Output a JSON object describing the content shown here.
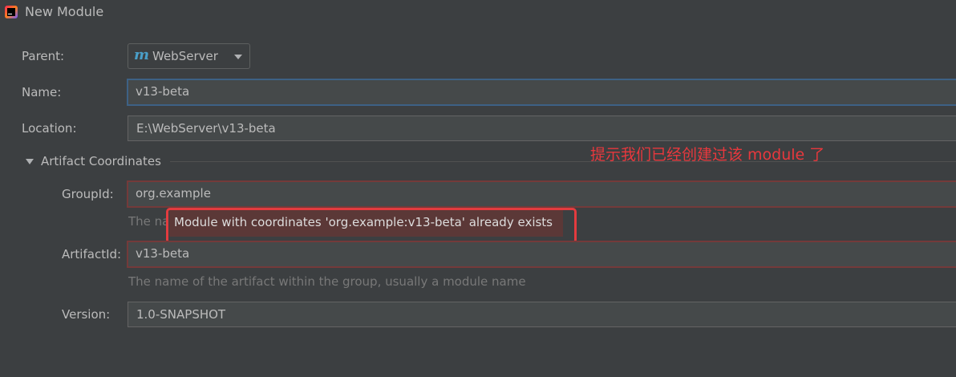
{
  "window": {
    "title": "New Module"
  },
  "form": {
    "parent": {
      "label": "Parent:",
      "value": "WebServer"
    },
    "name": {
      "label": "Name:",
      "value": "v13-beta"
    },
    "location": {
      "label": "Location:",
      "value": "E:\\WebServer\\v13-beta"
    },
    "artifact_section": {
      "title": "Artifact Coordinates"
    },
    "group_id": {
      "label": "GroupId:",
      "value": "org.example",
      "hint_prefix": "The na"
    },
    "error_tooltip": {
      "message": "Module with coordinates 'org.example:v13-beta' already exists"
    },
    "artifact_id": {
      "label": "ArtifactId:",
      "value": "v13-beta",
      "hint": "The name of the artifact within the group, usually a module name"
    },
    "version": {
      "label": "Version:",
      "value": "1.0-SNAPSHOT"
    }
  },
  "annotation": {
    "text": "提示我们已经创建过该 module 了"
  },
  "colors": {
    "background": "#3c3f41",
    "field_background": "#45494a",
    "focus_border": "#3d6185",
    "error_border": "#743a3a",
    "tooltip_background": "#5b3837",
    "annotation_red": "#e8383d"
  },
  "icons": {
    "app": "intellij-idea-icon",
    "parent_module": "maven-m-icon",
    "dropdown": "chevron-down-icon",
    "section_toggle": "triangle-down-icon"
  }
}
